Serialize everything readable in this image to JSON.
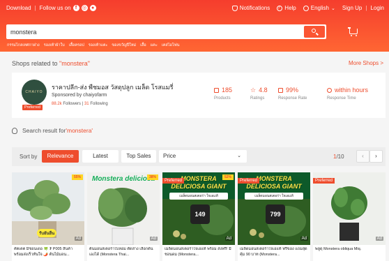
{
  "topbar": {
    "download": "Download",
    "follow": "Follow us on",
    "notifications": "Notifications",
    "help": "Help",
    "language": "English",
    "signup": "Sign Up",
    "login": "Login"
  },
  "search": {
    "value": "monstera"
  },
  "keywords": [
    "กรรมไกลเทศกาฝาง",
    "รองเท้าผ้าใบ",
    "เสื้อครอป",
    "รองเท้าแตะ",
    "ของขวัญปีใหม่",
    "เสื้อ",
    "แคะ",
    "เคสไอโฟน"
  ],
  "shops": {
    "title_prefix": "Shops related to ",
    "query": "\"monstera\"",
    "more": "More Shops >"
  },
  "shop": {
    "logo_text": "CHAIYO",
    "preferred": "Preferred",
    "name": "ราคาปลีก-ส่ง พืชมอส วัสดุปลูก เมล็ด โรสแมรี่",
    "sponsor": "Sponsored by chaiyofarm",
    "followers": "88.2k",
    "followers_label": "Followers",
    "following": "31",
    "following_label": "Following",
    "stats": [
      {
        "value": "185",
        "label": "Products",
        "icon": "products-icon"
      },
      {
        "value": "4.8",
        "label": "Ratings",
        "icon": "star-icon"
      },
      {
        "value": "99%",
        "label": "Response Rate",
        "icon": "chat-icon"
      },
      {
        "value": "within hours",
        "label": "Response Time",
        "icon": "clock-icon"
      }
    ]
  },
  "result": {
    "prefix": "Search result for ",
    "query": "'monstera'"
  },
  "sort": {
    "label": "Sort by",
    "relevance": "Relevance",
    "latest": "Latest",
    "top_sales": "Top Sales",
    "price": "Price",
    "page_current": "1",
    "page_total": "/10"
  },
  "products": [
    {
      "name": "คัตเตต มีชอนเดอ 🍀 ₮ P005 สินค้า พร้อมส่งเร็วทันใจ 🌶️ ต้นไม้มอน...",
      "badge": "55%",
      "receive": "รับยันยืน",
      "ad": "Ad"
    },
    {
      "name": "ต้นมอนสเตอร่าใบหอม ตัดสาง เลือกต้นเองได้ (Monstera Thai...",
      "overlay": "Monstera deliciosa",
      "badge": "38%",
      "ad": "Ad"
    },
    {
      "name": "เมล็ดมอนสเตอร่าใจเอแท้ พร้อม ส่งฟรี! มีชอนดม (Monstera...",
      "overlay": "MONSTERA DELICIOSA GIANT",
      "sub": "เมล็ดมอนสเตอร่า ใจเอแท้",
      "price": "149",
      "preferred": "Preferred",
      "badge": "52%",
      "ad": "Ad"
    },
    {
      "name": "เมล็ดมอนสเตอร่าใจเอแท้ ฟรีของ แถมสุดคุ้ม 90 บาท (Monstera...",
      "overlay": "MONSTERA DELICIOSA GIANT",
      "sub": "เมล็ดมอนสเตอร่า ใจเอแท้",
      "price": "799",
      "preferred": "Preferred",
      "ad": "Ad"
    },
    {
      "name": "พลูดุ Monstera obliqua Miq.",
      "preferred": "Preferred",
      "ad": "Ad"
    }
  ],
  "colors": {
    "brand": "#ee4d2d",
    "header_top": "#f53d2d",
    "header_bottom": "#ff6633"
  }
}
